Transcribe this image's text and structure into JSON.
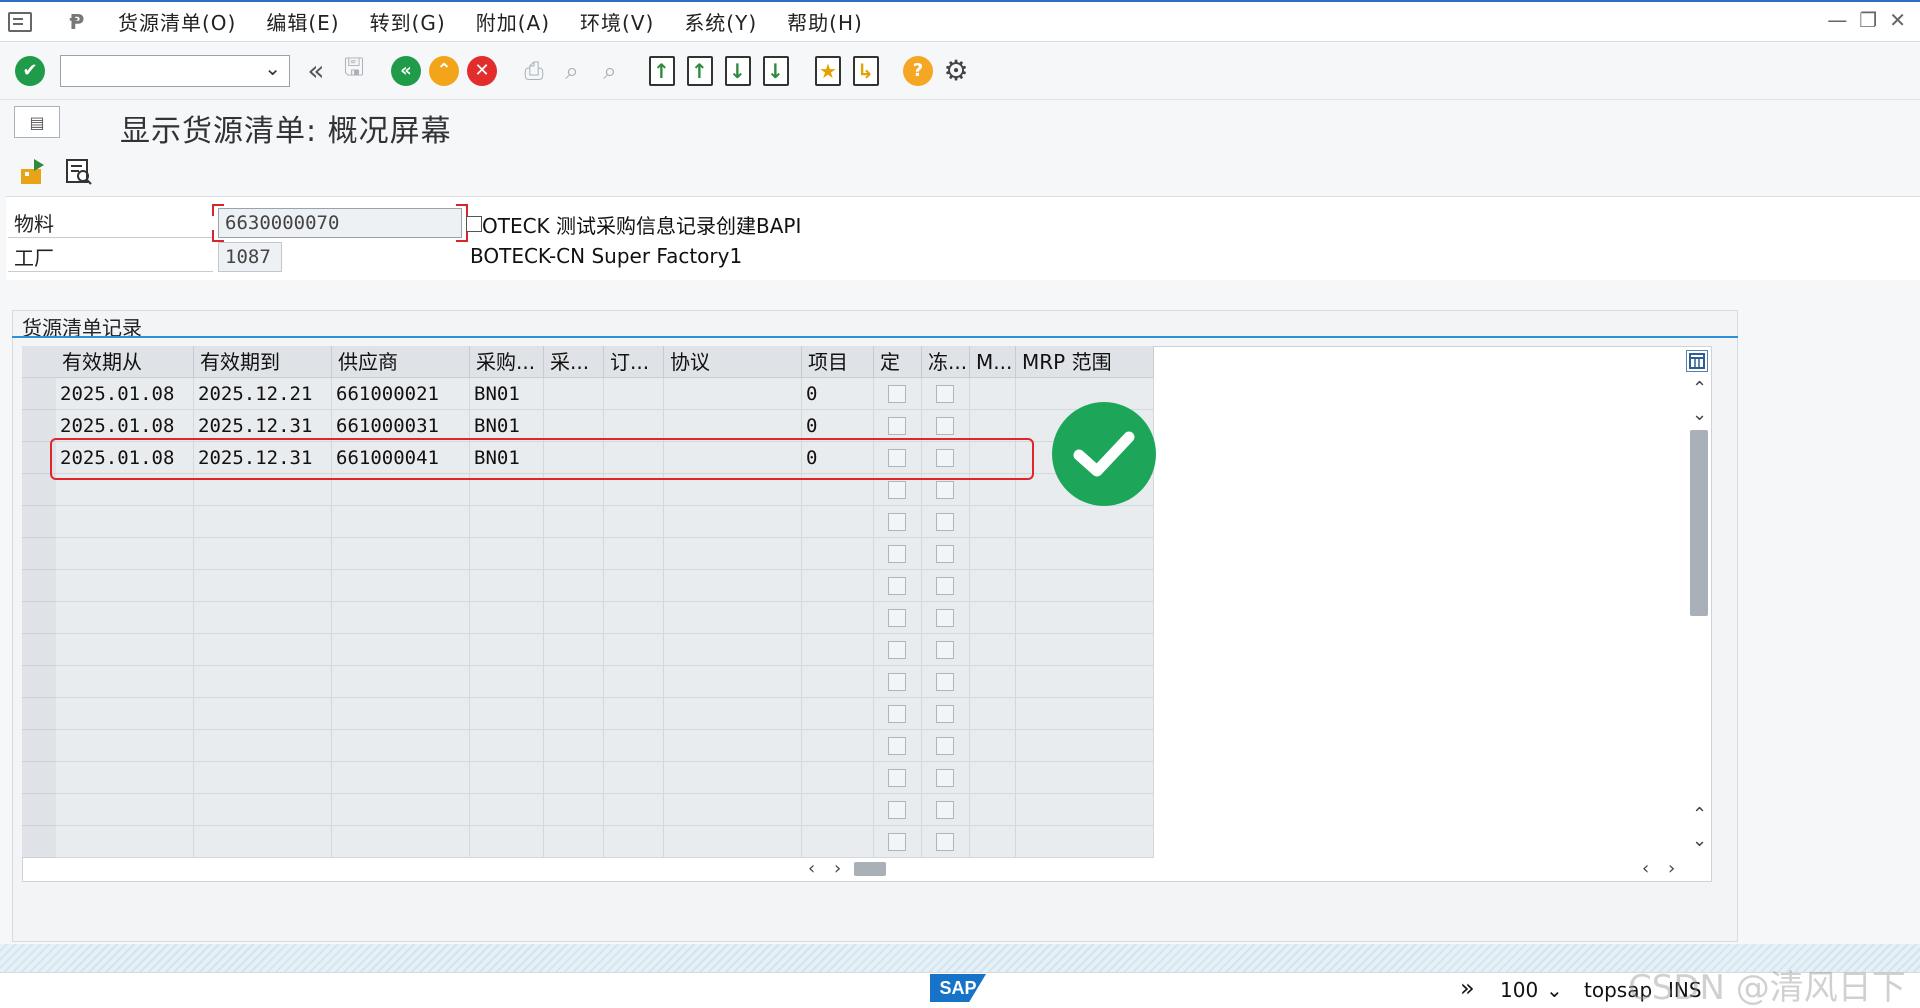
{
  "menu": [
    "货源清单(O)",
    "编辑(E)",
    "转到(G)",
    "附加(A)",
    "环境(V)",
    "系统(Y)",
    "帮助(H)"
  ],
  "command_field": {
    "value": "",
    "placeholder": ""
  },
  "screen_title": "显示货源清单: 概况屏幕",
  "header": {
    "material_label": "物料",
    "material_value": "6630000070",
    "material_desc": "OTECK 测试采购信息记录创建BAPI",
    "plant_label": "工厂",
    "plant_value": "1087",
    "plant_desc": "BOTECK-CN Super Factory1"
  },
  "group_title": "货源清单记录",
  "table": {
    "columns": [
      "有效期从",
      "有效期到",
      "供应商",
      "采购...",
      "采...",
      "订...",
      "协议",
      "项目",
      "定",
      "冻...",
      "M...",
      "MRP 范围"
    ],
    "rows": [
      [
        "2025.01.08",
        "2025.12.21",
        "661000021",
        "BN01",
        "",
        "",
        "",
        "0"
      ],
      [
        "2025.01.08",
        "2025.12.31",
        "661000031",
        "BN01",
        "",
        "",
        "",
        "0"
      ],
      [
        "2025.01.08",
        "2025.12.31",
        "661000041",
        "BN01",
        "",
        "",
        "",
        "0"
      ]
    ],
    "selected_row": 3,
    "empty_rows": 12
  },
  "status": {
    "zoom": "100",
    "system": "topsap",
    "mode": "INS",
    "logo": "SAP"
  },
  "watermark": "CSDN @清风日下",
  "colors": {
    "accent": "#2d8fd5",
    "ok_green": "#1da65a",
    "highlight_red": "#e0262b",
    "cancel_red": "#e32c2c",
    "back_green": "#1f9b49",
    "exit_orange": "#f2a51a",
    "help_orange": "#f5a623"
  }
}
